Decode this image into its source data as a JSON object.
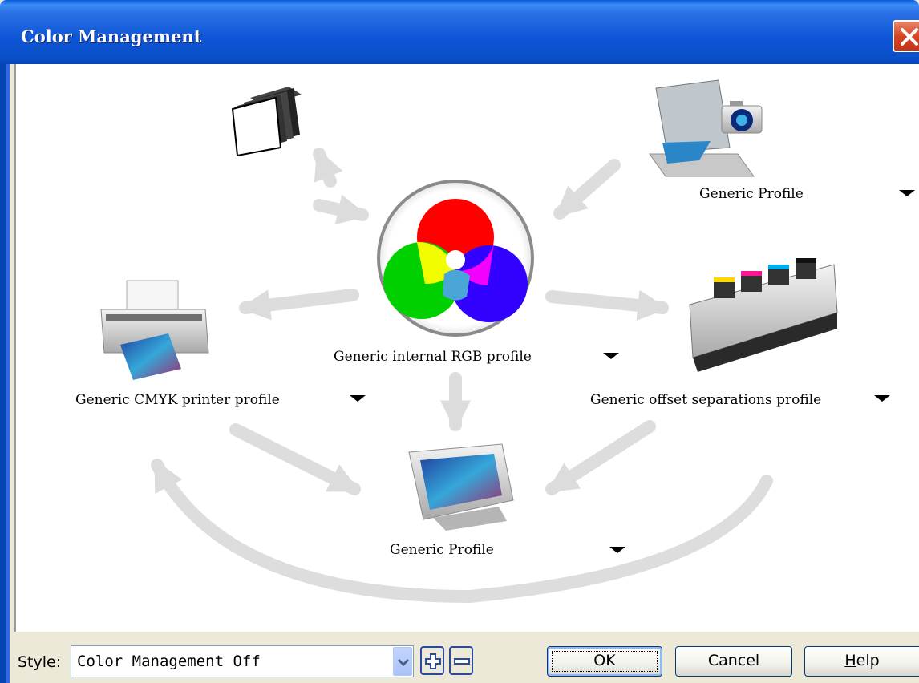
{
  "window": {
    "title": "Color Management"
  },
  "profiles": {
    "scanner_camera": "Generic Profile",
    "internal_rgb": "Generic internal RGB profile",
    "printer": "Generic CMYK printer profile",
    "offset_press": "Generic offset separations profile",
    "monitor": "Generic Profile"
  },
  "bottom": {
    "style_label": "Style:",
    "style_value": "Color Management Off",
    "ok_label": "OK",
    "cancel_label": "Cancel",
    "help_hotkey": "H",
    "help_rest": "elp"
  },
  "icons": {
    "documents": "documents-icon",
    "scanner_camera": "scanner-camera-icon",
    "rgb_circle": "rgb-color-wheel-icon",
    "printer": "printer-icon",
    "offset_press": "offset-press-icon",
    "monitor": "monitor-icon"
  },
  "colors": {
    "titlebar": "#0a4fc9",
    "close_button": "#d4411f",
    "flow_arrows": "#dddddd"
  }
}
